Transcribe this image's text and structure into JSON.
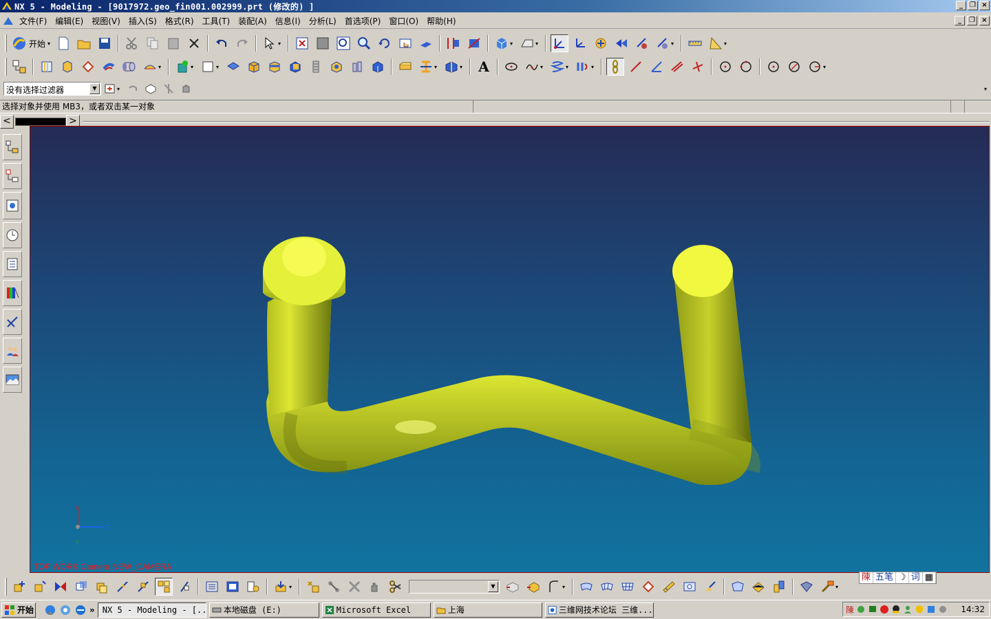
{
  "window": {
    "title": "NX 5 - Modeling - [9017972.geo_fin001.002999.prt (修改的) ]"
  },
  "menu": {
    "items": [
      "文件(F)",
      "编辑(E)",
      "视图(V)",
      "插入(S)",
      "格式(R)",
      "工具(T)",
      "装配(A)",
      "信息(I)",
      "分析(L)",
      "首选项(P)",
      "窗口(O)",
      "帮助(H)"
    ]
  },
  "toolbar": {
    "start_label": "开始"
  },
  "filter": {
    "value": "没有选择过滤器"
  },
  "status": {
    "prompt": "选择对象并使用 MB3，或者双击某一对象"
  },
  "viewport": {
    "label": "TOP WORK Camera NEW_CAMERA",
    "triad": {
      "x": "X",
      "y": "Y",
      "z": "Z"
    },
    "model_color": "#e6f03a",
    "label_color": "#ff1010"
  },
  "ime": {
    "items": [
      "陳",
      "五笔",
      "☽",
      "词",
      "▦"
    ]
  },
  "taskbar": {
    "start_label": "开始",
    "tasks": [
      "NX 5 - Modeling - [...",
      "本地磁盘 (E:)",
      "Microsoft Excel",
      "上海",
      "三维网技术论坛 三维..."
    ],
    "tray_text": "陳",
    "clock": "14:32"
  }
}
